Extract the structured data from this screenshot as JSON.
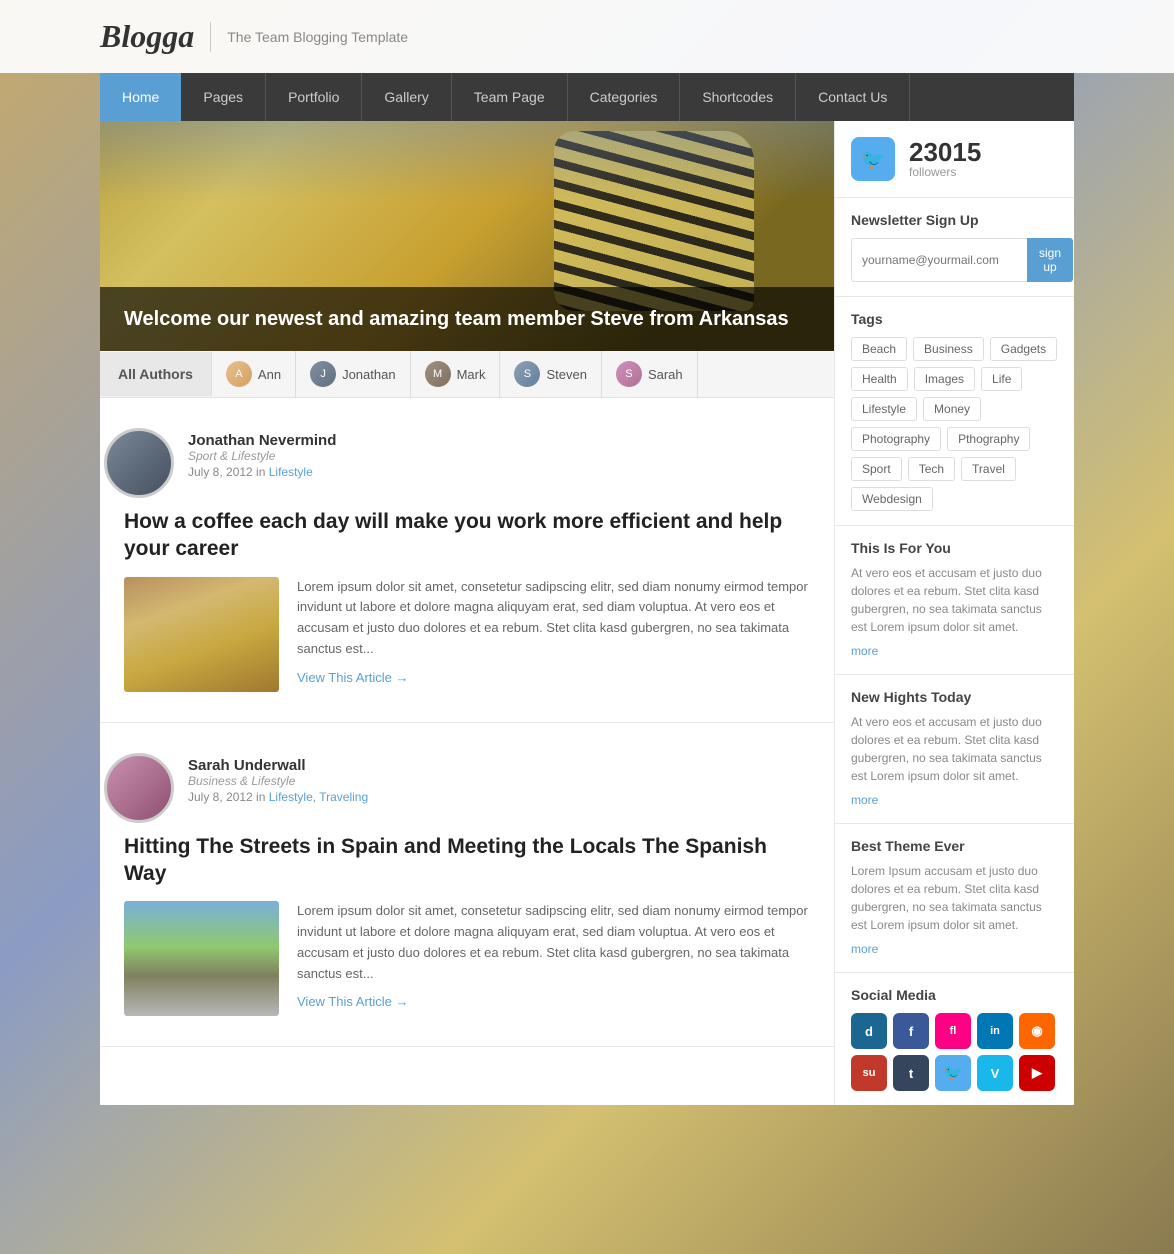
{
  "site": {
    "logo": "Blogga",
    "tagline": "The Team Blogging Template"
  },
  "nav": {
    "items": [
      {
        "label": "Home",
        "active": true
      },
      {
        "label": "Pages"
      },
      {
        "label": "Portfolio"
      },
      {
        "label": "Gallery"
      },
      {
        "label": "Team Page"
      },
      {
        "label": "Categories"
      },
      {
        "label": "Shortcodes"
      },
      {
        "label": "Contact Us"
      }
    ]
  },
  "hero": {
    "caption": "Welcome our newest and amazing team member Steve from Arkansas"
  },
  "author_bar": {
    "all_label": "All Authors",
    "authors": [
      {
        "name": "Ann"
      },
      {
        "name": "Jonathan"
      },
      {
        "name": "Mark"
      },
      {
        "name": "Steven"
      },
      {
        "name": "Sarah"
      }
    ]
  },
  "articles": [
    {
      "author_name": "Jonathan Nevermind",
      "author_role": "Sport & Lifestyle",
      "date": "July 8, 2012",
      "category": "Lifestyle",
      "title": "How a coffee each day will make you work more efficient and help your career",
      "excerpt": "Lorem ipsum dolor sit amet, consetetur sadipscing elitr, sed diam nonumy eirmod tempor invidunt ut labore et dolore magna aliquyam erat, sed diam voluptua. At vero eos et accusam et justo duo dolores et ea rebum. Stet clita kasd gubergren, no sea takimata sanctus est...",
      "view_label": "View This Article →",
      "category2": null
    },
    {
      "author_name": "Sarah Underwall",
      "author_role": "Business & Lifestyle",
      "date": "July 8, 2012",
      "category": "Lifestyle",
      "category2": "Traveling",
      "title": "Hitting The Streets in Spain and Meeting the Locals The Spanish Way",
      "excerpt": "Lorem ipsum dolor sit amet, consetetur sadipscing elitr, sed diam nonumy eirmod tempor invidunt ut labore et dolore magna aliquyam erat, sed diam voluptua. At vero eos et accusam et justo duo dolores et ea rebum. Stet clita kasd gubergren, no sea takimata sanctus est...",
      "view_label": "View This Article →"
    }
  ],
  "sidebar": {
    "twitter": {
      "count": "23015",
      "label": "followers"
    },
    "newsletter": {
      "title": "Newsletter Sign Up",
      "placeholder": "yourname@yourmail.com",
      "button": "sign up"
    },
    "tags": {
      "title": "Tags",
      "items": [
        "Beach",
        "Business",
        "Gadgets",
        "Health",
        "Images",
        "Life",
        "Lifestyle",
        "Money",
        "Photography",
        "Pthography",
        "Sport",
        "Tech",
        "Travel",
        "Webdesign"
      ]
    },
    "posts": [
      {
        "title": "This Is For You",
        "text": "At vero eos et accusam et justo duo dolores et ea rebum. Stet clita kasd gubergren, no sea takimata sanctus est Lorem ipsum dolor sit amet.",
        "more": "more"
      },
      {
        "title": "New Hights Today",
        "text": "At vero eos et accusam et justo duo dolores et ea rebum. Stet clita kasd gubergren, no sea takimata sanctus est Lorem ipsum dolor sit amet.",
        "more": "more"
      },
      {
        "title": "Best Theme Ever",
        "text": "Lorem Ipsum accusam et justo duo dolores et ea rebum. Stet clita kasd gubergren, no sea takimata sanctus est Lorem ipsum dolor sit amet.",
        "more": "more"
      }
    ],
    "social": {
      "title": "Social Media",
      "icons": [
        {
          "name": "Digg",
          "class": "si-digg",
          "symbol": "D"
        },
        {
          "name": "Facebook",
          "class": "si-fb",
          "symbol": "f"
        },
        {
          "name": "Flickr",
          "class": "si-flickr",
          "symbol": "✿"
        },
        {
          "name": "LinkedIn",
          "class": "si-li",
          "symbol": "in"
        },
        {
          "name": "RSS",
          "class": "si-rss",
          "symbol": "◉"
        },
        {
          "name": "StumbleUpon",
          "class": "si-su",
          "symbol": "su"
        },
        {
          "name": "Tumblr",
          "class": "si-tumblr",
          "symbol": "t"
        },
        {
          "name": "Twitter",
          "class": "si-tw",
          "symbol": "🐦"
        },
        {
          "name": "Vimeo",
          "class": "si-vimeo",
          "symbol": "V"
        },
        {
          "name": "YouTube",
          "class": "si-yt",
          "symbol": "▶"
        }
      ]
    }
  }
}
